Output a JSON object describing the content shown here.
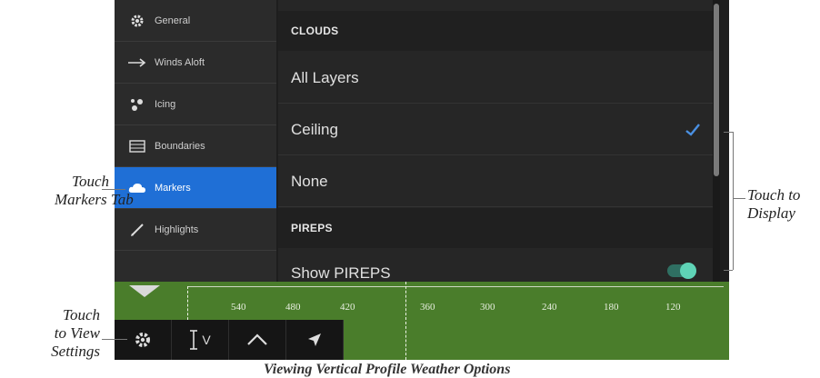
{
  "sidebar": {
    "items": [
      {
        "label": "General",
        "icon": "gear-icon"
      },
      {
        "label": "Winds Aloft",
        "icon": "arrow-right-icon"
      },
      {
        "label": "Icing",
        "icon": "icing-icon"
      },
      {
        "label": "Boundaries",
        "icon": "boundaries-icon"
      },
      {
        "label": "Markers",
        "icon": "cloud-icon",
        "active": true
      },
      {
        "label": "Highlights",
        "icon": "pencil-icon"
      }
    ]
  },
  "panel": {
    "clouds_header": "CLOUDS",
    "options": [
      {
        "label": "All Layers",
        "checked": false
      },
      {
        "label": "Ceiling",
        "checked": true
      },
      {
        "label": "None",
        "checked": false
      }
    ],
    "pireps_header": "PIREPS",
    "show_pireps_label": "Show PIREPS",
    "show_pireps_on": true
  },
  "profile": {
    "ticks": [
      "540",
      "480",
      "420",
      "360",
      "300",
      "240",
      "180",
      "120"
    ]
  },
  "toolbar": {
    "buttons": [
      "gear-icon",
      "altitude-icon",
      "profile-chevron-icon",
      "direct-to-arrow-icon"
    ],
    "altitude_label": "V"
  },
  "callouts": {
    "markers": "Touch\nMarkers Tab",
    "display": "Touch to\nDisplay",
    "settings": "Touch\nto View\nSettings"
  },
  "caption": "Viewing Vertical Profile Weather Options",
  "colors": {
    "accent": "#1f6fd6",
    "check": "#4a90e2",
    "profile": "#4a7d2b",
    "toggle": "#5fd3b6"
  }
}
